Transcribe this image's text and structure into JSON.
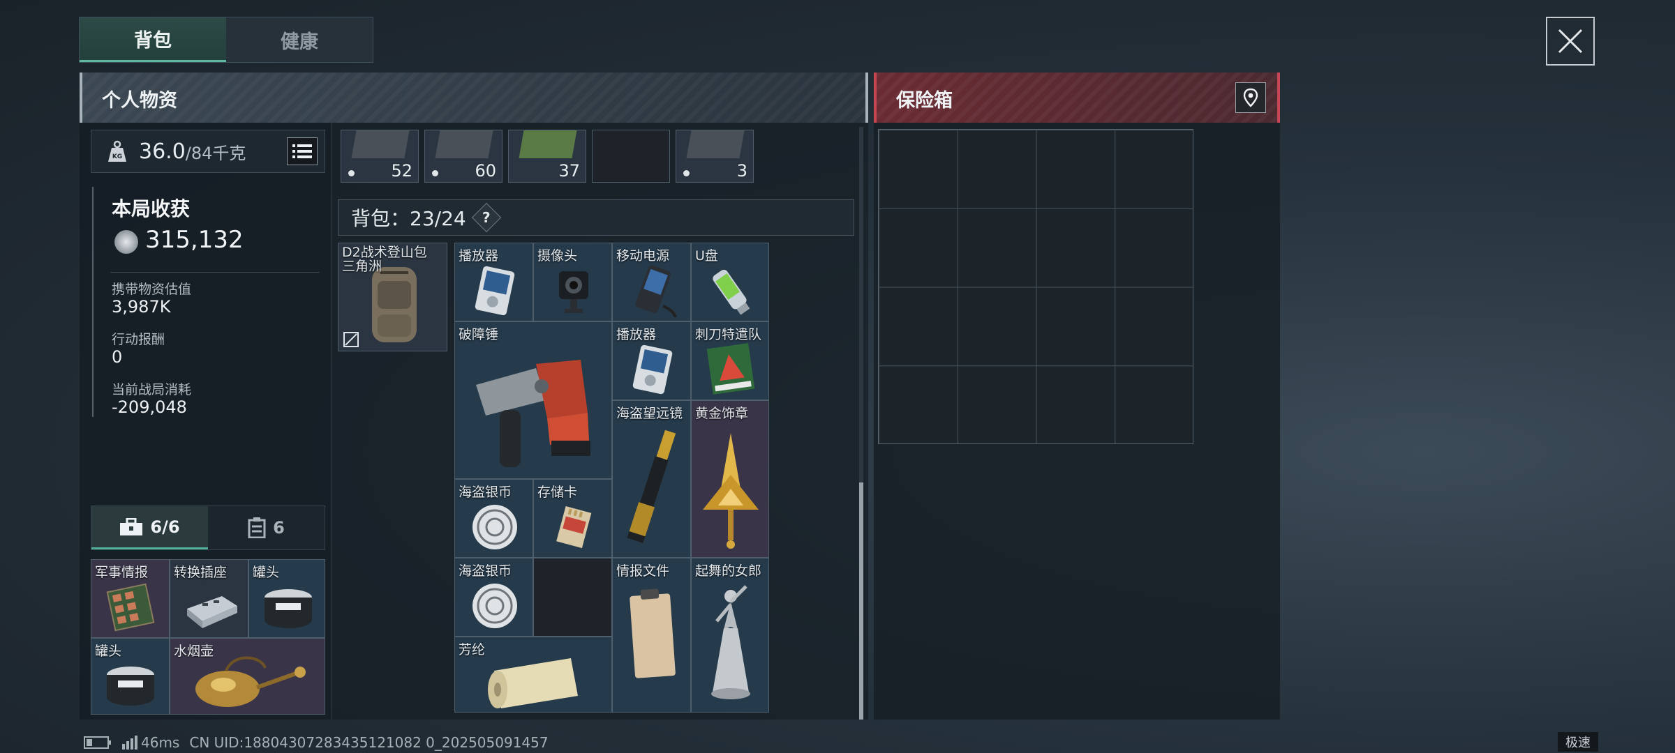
{
  "tabs": {
    "backpack": "背包",
    "health": "健康"
  },
  "header": {
    "personal": "个人物资",
    "safe": "保险箱"
  },
  "weight": {
    "current": "36.0",
    "total": "/84千克",
    "icon": "kg-weight-icon"
  },
  "stats": {
    "round_gain_label": "本局收获",
    "round_gain_value": "315,132",
    "carry_value_label": "携带物资估值",
    "carry_value": "3,987K",
    "reward_label": "行动报酬",
    "reward_value": "0",
    "cost_label": "当前战局消耗",
    "cost_value": "-209,048"
  },
  "ammo_row": [
    "52",
    "60",
    "37",
    "",
    "3"
  ],
  "backpack": {
    "label": "背包：23/24",
    "help": "?",
    "name_line1": "D2战术登山包",
    "name_line2": "三角洲"
  },
  "bag_items": [
    {
      "name": "播放器",
      "rarity": "blue"
    },
    {
      "name": "摄像头",
      "rarity": "blue"
    },
    {
      "name": "移动电源",
      "rarity": "blue"
    },
    {
      "name": "U盘",
      "rarity": "blue"
    },
    {
      "name": "破障锤",
      "rarity": "blue"
    },
    {
      "name": "播放器",
      "rarity": "blue"
    },
    {
      "name": "刺刀特遣队",
      "rarity": "blue"
    },
    {
      "name": "海盗望远镜",
      "rarity": "blue"
    },
    {
      "name": "黄金饰章",
      "rarity": "purple"
    },
    {
      "name": "海盗银币",
      "rarity": "blue"
    },
    {
      "name": "存储卡",
      "rarity": "blue"
    },
    {
      "name": "海盗银币",
      "rarity": "blue"
    },
    {
      "name": "情报文件",
      "rarity": "blue"
    },
    {
      "name": "起舞的女郎",
      "rarity": "blue"
    },
    {
      "name": "芳纶",
      "rarity": "blue"
    }
  ],
  "subtabs": {
    "pouch": "6/6",
    "case": "6"
  },
  "pouch_items": [
    {
      "name": "军事情报",
      "rarity": "purple"
    },
    {
      "name": "转换插座",
      "rarity": "blue"
    },
    {
      "name": "罐头",
      "rarity": "blue"
    },
    {
      "name": "罐头",
      "rarity": "blue"
    },
    {
      "name": "水烟壶",
      "rarity": "purple"
    }
  ],
  "status": {
    "ping": "46ms",
    "uid": "CN UID:18804307283435121082 0_202505091457",
    "speed": "极速"
  },
  "colors": {
    "accent": "#5fb8a0",
    "safe_red": "#c64753",
    "blue_item": "#253a4b",
    "purple_item": "#3a3448"
  }
}
